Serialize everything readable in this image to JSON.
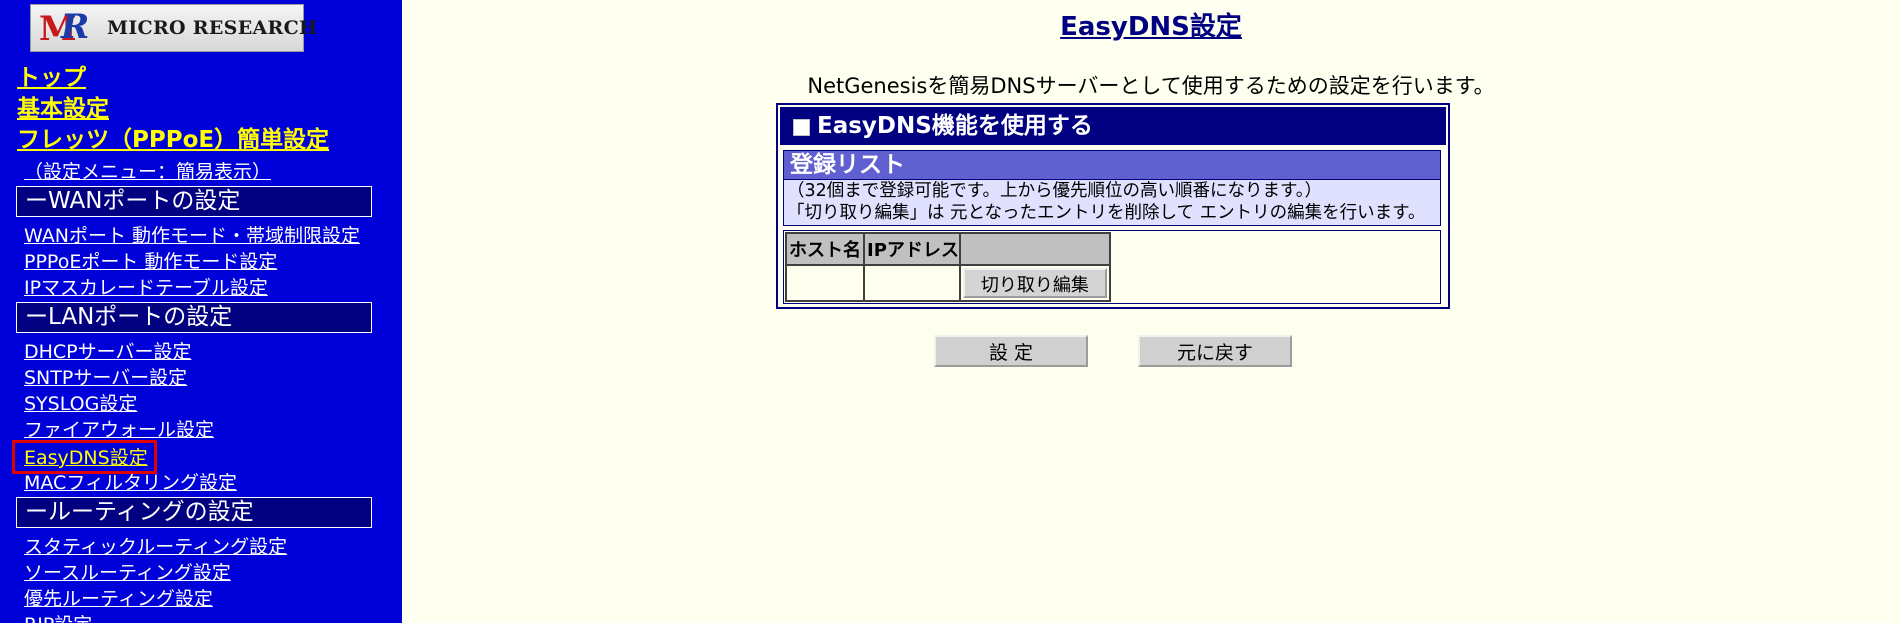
{
  "logo": {
    "mark": "MR",
    "name": "MICRO RESEARCH"
  },
  "sidebar": {
    "top_links": [
      "トップ",
      "基本設定",
      "フレッツ（PPPoE）簡単設定"
    ],
    "menu_mode_link": "（設定メニュー：簡易表示）",
    "sections": [
      {
        "heading": "ーWANポートの設定",
        "items": [
          "WANポート 動作モード・帯域制限設定",
          "PPPoEポート 動作モード設定",
          "IPマスカレードテーブル設定"
        ]
      },
      {
        "heading": "ーLANポートの設定",
        "items": [
          "DHCPサーバー設定",
          "SNTPサーバー設定",
          "SYSLOG設定",
          "ファイアウォール設定",
          "EasyDNS設定",
          "MACフィルタリング設定"
        ]
      },
      {
        "heading": "ールーティングの設定",
        "items": [
          "スタティックルーティング設定",
          "ソースルーティング設定",
          "優先ルーティング設定",
          "RIP設定"
        ]
      }
    ],
    "selected_item": "EasyDNS設定"
  },
  "main": {
    "title": "EasyDNS設定",
    "description": "NetGenesisを簡易DNSサーバーとして使用するための設定を行います。",
    "enable_checkbox": {
      "label": "EasyDNS機能を使用する",
      "checked": false
    },
    "registration": {
      "heading": "登録リスト",
      "notes": [
        "（32個まで登録可能です。上から優先順位の高い順番になります。）",
        "「切り取り編集」は 元となったエントリを削除して エントリの編集を行います。"
      ],
      "columns": [
        "ホスト名",
        "IPアドレス",
        ""
      ],
      "cut_button": "切り取り編集"
    },
    "buttons": {
      "set": "設 定",
      "revert": "元に戻す"
    }
  },
  "colors": {
    "sidebar_bg": "#0000d8",
    "section_bg": "#000080",
    "link_yellow": "#ffff00",
    "page_bg": "#fffff0",
    "selection_outline": "#e00000"
  }
}
